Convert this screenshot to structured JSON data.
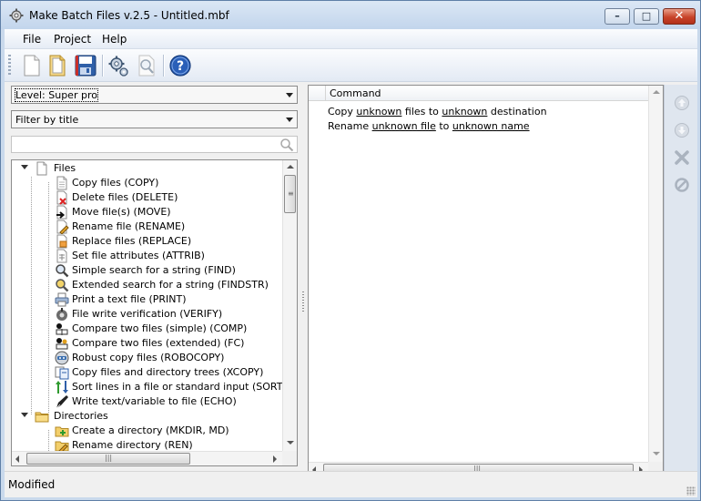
{
  "window": {
    "title": "Make Batch Files v.2.5 - Untitled.mbf",
    "minimize_glyph": "–",
    "maximize_glyph": "□",
    "close_glyph": "✕"
  },
  "menu": {
    "file": "File",
    "project": "Project",
    "help": "Help"
  },
  "toolbar": {
    "icons": [
      "new-file-icon",
      "open-file-icon",
      "save-file-icon",
      "settings-gears-icon",
      "preview-magnifier-icon",
      "help-icon"
    ]
  },
  "level_select": {
    "value": "Level: Super pro"
  },
  "filter_select": {
    "value": "Filter by title"
  },
  "search": {
    "value": ""
  },
  "tree": {
    "groups": [
      {
        "label": "Files",
        "items": [
          {
            "label": "Copy files (COPY)",
            "icon": "copy-icon"
          },
          {
            "label": "Delete files (DELETE)",
            "icon": "delete-file-icon"
          },
          {
            "label": "Move file(s) (MOVE)",
            "icon": "move-file-icon"
          },
          {
            "label": "Rename file (RENAME)",
            "icon": "rename-file-icon"
          },
          {
            "label": "Replace files (REPLACE)",
            "icon": "replace-file-icon"
          },
          {
            "label": "Set file attributes (ATTRIB)",
            "icon": "attrib-icon"
          },
          {
            "label": "Simple search for a string (FIND)",
            "icon": "find-icon"
          },
          {
            "label": "Extended search for a string (FINDSTR)",
            "icon": "findstr-icon"
          },
          {
            "label": "Print a text file (PRINT)",
            "icon": "print-icon"
          },
          {
            "label": "File write verification (VERIFY)",
            "icon": "verify-icon"
          },
          {
            "label": "Compare two files (simple) (COMP)",
            "icon": "compare-icon"
          },
          {
            "label": "Compare two files (extended) (FC)",
            "icon": "compare-extended-icon"
          },
          {
            "label": "Robust copy files (ROBOCOPY)",
            "icon": "robocopy-icon"
          },
          {
            "label": "Copy files and directory trees (XCOPY)",
            "icon": "xcopy-icon"
          },
          {
            "label": "Sort lines in a file or standard input (SORT)",
            "icon": "sort-icon"
          },
          {
            "label": "Write text/variable to file (ECHO)",
            "icon": "echo-pen-icon"
          }
        ]
      },
      {
        "label": "Directories",
        "items": [
          {
            "label": "Create a directory (MKDIR, MD)",
            "icon": "create-folder-icon"
          },
          {
            "label": "Rename directory (REN)",
            "icon": "rename-folder-icon"
          }
        ]
      }
    ]
  },
  "commands": {
    "header": "Command",
    "lines": [
      {
        "pre": "Copy ",
        "link1": "unknown",
        "mid": " files to ",
        "link2": "unknown",
        "post": " destination"
      },
      {
        "pre": "Rename ",
        "link1": "unknown file",
        "mid": " to ",
        "link2": "unknown name",
        "post": ""
      }
    ]
  },
  "side_buttons": [
    "move-up-icon",
    "move-down-icon",
    "delete-x-icon",
    "disable-icon"
  ],
  "status": {
    "text": "Modified"
  },
  "colors": {
    "title_bar": "#c2d5ec",
    "close_button": "#c8442a",
    "accent_blue": "#1f5fbf"
  }
}
